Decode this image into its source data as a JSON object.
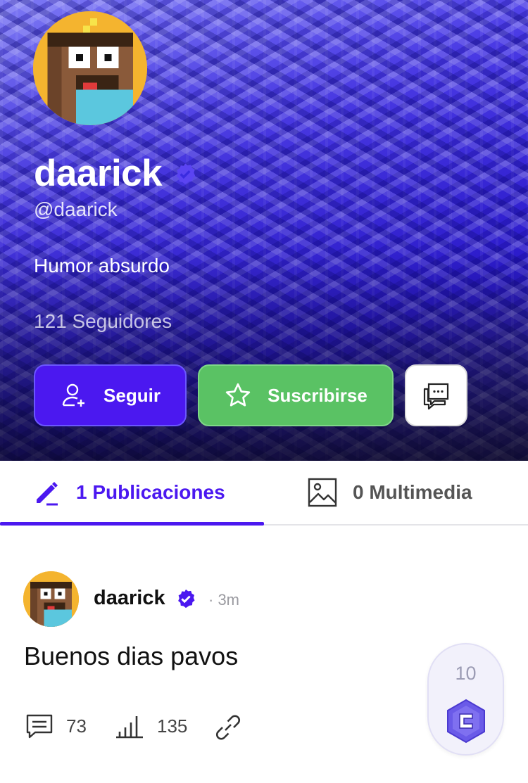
{
  "profile": {
    "display_name": "daarick",
    "handle": "@daarick",
    "bio": "Humor absurdo",
    "followers": "121 Seguidores",
    "verified_icon": "verified-badge-icon",
    "avatar_icon": "pixel-character-avatar"
  },
  "actions": {
    "follow_label": "Seguir",
    "subscribe_label": "Suscribirse",
    "message_icon": "chat-bubbles-icon"
  },
  "tabs": [
    {
      "label": "1 Publicaciones",
      "icon": "pencil-icon",
      "active": true
    },
    {
      "label": "0 Multimedia",
      "icon": "image-icon",
      "active": false
    }
  ],
  "post": {
    "author": "daarick",
    "time": "· 3m",
    "text": "Buenos dias pavos",
    "comments": "73",
    "views": "135",
    "vote_count": "10"
  },
  "colors": {
    "accent": "#4b18f0",
    "subscribe_green": "#5ac264",
    "avatar_bg": "#f4b42f"
  }
}
